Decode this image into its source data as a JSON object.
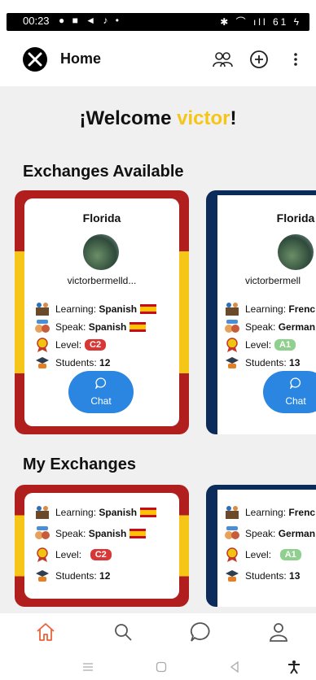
{
  "status": {
    "time": "00:23",
    "left_icons": "● ■ ◄ ♪ •",
    "right_icons": "✱ ⌒ ıll 61 ϟ"
  },
  "header": {
    "title": "Home"
  },
  "welcome": {
    "prefix": "¡Welcome ",
    "user": "victor",
    "suffix": "!"
  },
  "sections": {
    "available": "Exchanges Available",
    "mine": "My Exchanges"
  },
  "available": [
    {
      "city": "Florida",
      "username": "victorbermelld...",
      "learning_label": "Learning:",
      "learning": "Spanish",
      "speak_label": "Speak:",
      "speak": "Spanish",
      "level_label": "Level:",
      "level": "C2",
      "students_label": "Students:",
      "students": "12",
      "chat": "Chat"
    },
    {
      "city": "Florida",
      "username": "victorbermell",
      "learning_label": "Learning:",
      "learning": "Frenc",
      "speak_label": "Speak:",
      "speak": "German",
      "level_label": "Level:",
      "level": "A1",
      "students_label": "Students:",
      "students": "13",
      "chat": "Chat"
    }
  ],
  "mine": [
    {
      "learning_label": "Learning:",
      "learning": "Spanish",
      "speak_label": "Speak:",
      "speak": "Spanish",
      "level_label": "Level:",
      "level": "C2",
      "students_label": "Students:",
      "students": "12"
    },
    {
      "learning_label": "Learning:",
      "learning": "Frenc",
      "speak_label": "Speak:",
      "speak": "German",
      "level_label": "Level:",
      "level": "A1",
      "students_label": "Students:",
      "students": "13"
    }
  ],
  "colors": {
    "accent": "#f5c518",
    "primary": "#2a86e0",
    "c2": "#d93636",
    "a1": "#8fd08f",
    "nav_active": "#e8643c"
  }
}
